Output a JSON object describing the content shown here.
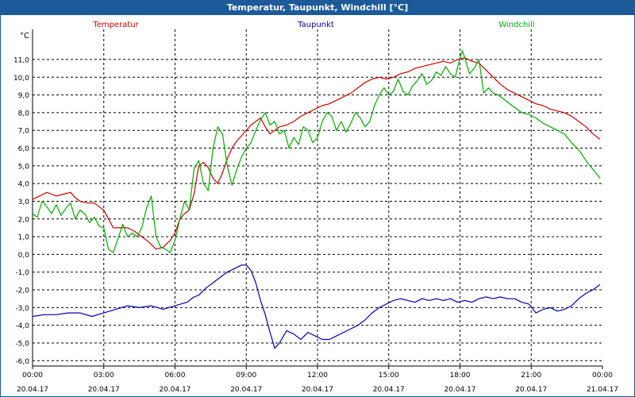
{
  "window": {
    "title": "Temperatur, Taupunkt, Windchill [°C]"
  },
  "chart_data": {
    "type": "line",
    "ylabel": "°C",
    "ylim": [
      -6.3,
      12.7
    ],
    "xlim": [
      0,
      24
    ],
    "grid": true,
    "legend_position": "top",
    "y_ticks": [
      {
        "value": 11,
        "label": "11,0"
      },
      {
        "value": 10,
        "label": "10,0"
      },
      {
        "value": 9,
        "label": "9,0"
      },
      {
        "value": 8,
        "label": "8,0"
      },
      {
        "value": 7,
        "label": "7,0"
      },
      {
        "value": 6,
        "label": "6,0"
      },
      {
        "value": 5,
        "label": "5,0"
      },
      {
        "value": 4,
        "label": "4,0"
      },
      {
        "value": 3,
        "label": "3,0"
      },
      {
        "value": 2,
        "label": "2,0"
      },
      {
        "value": 1,
        "label": "1,0"
      },
      {
        "value": 0,
        "label": "0,0"
      },
      {
        "value": -1,
        "label": "-1,0"
      },
      {
        "value": -2,
        "label": "-2,0"
      },
      {
        "value": -3,
        "label": "-3,0"
      },
      {
        "value": -4,
        "label": "-4,0"
      },
      {
        "value": -5,
        "label": "-5,0"
      },
      {
        "value": -6,
        "label": "-6,0"
      }
    ],
    "x_ticks": [
      {
        "value": 0,
        "time": "00:00",
        "date": "20.04.17"
      },
      {
        "value": 3,
        "time": "03:00",
        "date": "20.04.17"
      },
      {
        "value": 6,
        "time": "06:00",
        "date": "20.04.17"
      },
      {
        "value": 9,
        "time": "09:00",
        "date": "20.04.17"
      },
      {
        "value": 12,
        "time": "12:00",
        "date": "20.04.17"
      },
      {
        "value": 15,
        "time": "15:00",
        "date": "20.04.17"
      },
      {
        "value": 18,
        "time": "18:00",
        "date": "20.04.17"
      },
      {
        "value": 21,
        "time": "21:00",
        "date": "20.04.17"
      },
      {
        "value": 24,
        "time": "00:00",
        "date": "21.04.17"
      }
    ],
    "series": [
      {
        "name": "Temperatur",
        "color": "#cc0000",
        "points": [
          [
            0,
            3.1
          ],
          [
            0.3,
            3.3
          ],
          [
            0.6,
            3.5
          ],
          [
            0.8,
            3.4
          ],
          [
            1.0,
            3.3
          ],
          [
            1.3,
            3.4
          ],
          [
            1.6,
            3.5
          ],
          [
            1.8,
            3.2
          ],
          [
            2.0,
            3.0
          ],
          [
            2.3,
            2.9
          ],
          [
            2.6,
            2.9
          ],
          [
            2.8,
            2.7
          ],
          [
            3.0,
            2.5
          ],
          [
            3.2,
            2.0
          ],
          [
            3.4,
            1.5
          ],
          [
            3.7,
            1.5
          ],
          [
            4.0,
            1.5
          ],
          [
            4.3,
            1.3
          ],
          [
            4.6,
            1.0
          ],
          [
            4.9,
            0.7
          ],
          [
            5.2,
            0.3
          ],
          [
            5.5,
            0.4
          ],
          [
            5.8,
            0.8
          ],
          [
            6.0,
            1.2
          ],
          [
            6.2,
            2.0
          ],
          [
            6.4,
            2.3
          ],
          [
            6.6,
            2.5
          ],
          [
            6.8,
            3.4
          ],
          [
            7.0,
            5.0
          ],
          [
            7.2,
            5.2
          ],
          [
            7.4,
            4.9
          ],
          [
            7.6,
            4.3
          ],
          [
            7.8,
            4.0
          ],
          [
            8.0,
            4.6
          ],
          [
            8.2,
            5.4
          ],
          [
            8.4,
            6.0
          ],
          [
            8.6,
            6.4
          ],
          [
            8.8,
            6.7
          ],
          [
            9.0,
            7.0
          ],
          [
            9.2,
            7.3
          ],
          [
            9.4,
            7.5
          ],
          [
            9.6,
            7.7
          ],
          [
            9.8,
            7.2
          ],
          [
            10.0,
            6.8
          ],
          [
            10.2,
            7.0
          ],
          [
            10.4,
            7.2
          ],
          [
            10.7,
            7.3
          ],
          [
            11.0,
            7.5
          ],
          [
            11.3,
            7.8
          ],
          [
            11.6,
            8.0
          ],
          [
            11.9,
            8.2
          ],
          [
            12.2,
            8.4
          ],
          [
            12.5,
            8.5
          ],
          [
            12.8,
            8.7
          ],
          [
            13.1,
            8.9
          ],
          [
            13.4,
            9.1
          ],
          [
            13.7,
            9.4
          ],
          [
            14.0,
            9.7
          ],
          [
            14.3,
            9.9
          ],
          [
            14.6,
            10.0
          ],
          [
            14.9,
            9.9
          ],
          [
            15.2,
            10.0
          ],
          [
            15.5,
            10.2
          ],
          [
            15.8,
            10.3
          ],
          [
            16.1,
            10.5
          ],
          [
            16.4,
            10.6
          ],
          [
            16.7,
            10.7
          ],
          [
            17.0,
            10.8
          ],
          [
            17.3,
            10.9
          ],
          [
            17.6,
            10.8
          ],
          [
            17.9,
            11.0
          ],
          [
            18.2,
            11.1
          ],
          [
            18.5,
            10.9
          ],
          [
            18.8,
            10.8
          ],
          [
            19.1,
            10.4
          ],
          [
            19.4,
            10.0
          ],
          [
            19.7,
            9.6
          ],
          [
            20.0,
            9.3
          ],
          [
            20.3,
            9.1
          ],
          [
            20.6,
            8.9
          ],
          [
            20.9,
            8.7
          ],
          [
            21.2,
            8.5
          ],
          [
            21.5,
            8.4
          ],
          [
            21.8,
            8.2
          ],
          [
            22.1,
            8.1
          ],
          [
            22.4,
            8.0
          ],
          [
            22.7,
            7.8
          ],
          [
            23.0,
            7.5
          ],
          [
            23.3,
            7.2
          ],
          [
            23.6,
            6.8
          ],
          [
            23.9,
            6.5
          ]
        ]
      },
      {
        "name": "Taupunkt",
        "color": "#0000aa",
        "points": [
          [
            0,
            -3.5
          ],
          [
            0.5,
            -3.4
          ],
          [
            1.0,
            -3.4
          ],
          [
            1.5,
            -3.3
          ],
          [
            2.0,
            -3.3
          ],
          [
            2.5,
            -3.5
          ],
          [
            3.0,
            -3.3
          ],
          [
            3.5,
            -3.1
          ],
          [
            4.0,
            -2.9
          ],
          [
            4.5,
            -3.0
          ],
          [
            5.0,
            -2.9
          ],
          [
            5.5,
            -3.1
          ],
          [
            6.0,
            -2.9
          ],
          [
            6.5,
            -2.7
          ],
          [
            6.8,
            -2.4
          ],
          [
            7.0,
            -2.3
          ],
          [
            7.3,
            -1.9
          ],
          [
            7.6,
            -1.6
          ],
          [
            7.9,
            -1.3
          ],
          [
            8.2,
            -1.0
          ],
          [
            8.5,
            -0.8
          ],
          [
            8.8,
            -0.6
          ],
          [
            9.0,
            -0.6
          ],
          [
            9.2,
            -0.9
          ],
          [
            9.4,
            -1.6
          ],
          [
            9.6,
            -2.6
          ],
          [
            9.8,
            -3.4
          ],
          [
            10.0,
            -4.4
          ],
          [
            10.2,
            -5.3
          ],
          [
            10.4,
            -5.0
          ],
          [
            10.7,
            -4.3
          ],
          [
            11.0,
            -4.5
          ],
          [
            11.3,
            -4.8
          ],
          [
            11.6,
            -4.4
          ],
          [
            11.9,
            -4.6
          ],
          [
            12.2,
            -4.8
          ],
          [
            12.5,
            -4.8
          ],
          [
            12.8,
            -4.6
          ],
          [
            13.1,
            -4.4
          ],
          [
            13.4,
            -4.2
          ],
          [
            13.7,
            -4.0
          ],
          [
            14.0,
            -3.7
          ],
          [
            14.3,
            -3.3
          ],
          [
            14.6,
            -3.0
          ],
          [
            14.9,
            -2.8
          ],
          [
            15.2,
            -2.6
          ],
          [
            15.5,
            -2.5
          ],
          [
            15.8,
            -2.6
          ],
          [
            16.1,
            -2.7
          ],
          [
            16.4,
            -2.5
          ],
          [
            16.7,
            -2.6
          ],
          [
            17.0,
            -2.5
          ],
          [
            17.3,
            -2.6
          ],
          [
            17.6,
            -2.5
          ],
          [
            17.9,
            -2.7
          ],
          [
            18.2,
            -2.6
          ],
          [
            18.5,
            -2.7
          ],
          [
            18.8,
            -2.5
          ],
          [
            19.1,
            -2.4
          ],
          [
            19.4,
            -2.5
          ],
          [
            19.7,
            -2.4
          ],
          [
            20.0,
            -2.5
          ],
          [
            20.3,
            -2.5
          ],
          [
            20.6,
            -2.7
          ],
          [
            20.9,
            -2.8
          ],
          [
            21.2,
            -3.3
          ],
          [
            21.5,
            -3.1
          ],
          [
            21.8,
            -3.0
          ],
          [
            22.1,
            -3.2
          ],
          [
            22.4,
            -3.1
          ],
          [
            22.7,
            -2.9
          ],
          [
            23.0,
            -2.5
          ],
          [
            23.3,
            -2.2
          ],
          [
            23.6,
            -2.0
          ],
          [
            23.9,
            -1.7
          ]
        ]
      },
      {
        "name": "Windchill",
        "color": "#00aa00",
        "points": [
          [
            0,
            2.3
          ],
          [
            0.2,
            2.1
          ],
          [
            0.4,
            3.0
          ],
          [
            0.6,
            2.7
          ],
          [
            0.8,
            2.3
          ],
          [
            1.0,
            2.8
          ],
          [
            1.2,
            2.2
          ],
          [
            1.4,
            2.6
          ],
          [
            1.6,
            2.9
          ],
          [
            1.8,
            2.0
          ],
          [
            2.0,
            2.5
          ],
          [
            2.2,
            2.3
          ],
          [
            2.4,
            1.8
          ],
          [
            2.6,
            2.1
          ],
          [
            2.8,
            1.6
          ],
          [
            3.0,
            1.5
          ],
          [
            3.2,
            0.3
          ],
          [
            3.4,
            0.1
          ],
          [
            3.6,
            0.9
          ],
          [
            3.8,
            1.7
          ],
          [
            4.0,
            1.0
          ],
          [
            4.2,
            1.2
          ],
          [
            4.4,
            1.0
          ],
          [
            4.6,
            1.5
          ],
          [
            4.8,
            2.6
          ],
          [
            5.0,
            3.3
          ],
          [
            5.2,
            1.0
          ],
          [
            5.4,
            0.4
          ],
          [
            5.6,
            0.3
          ],
          [
            5.8,
            0.1
          ],
          [
            6.0,
            0.8
          ],
          [
            6.2,
            2.0
          ],
          [
            6.4,
            3.0
          ],
          [
            6.6,
            2.5
          ],
          [
            6.8,
            4.8
          ],
          [
            7.0,
            5.3
          ],
          [
            7.2,
            4.0
          ],
          [
            7.4,
            3.6
          ],
          [
            7.6,
            6.0
          ],
          [
            7.8,
            7.2
          ],
          [
            8.0,
            6.8
          ],
          [
            8.2,
            5.0
          ],
          [
            8.4,
            3.9
          ],
          [
            8.6,
            4.8
          ],
          [
            8.8,
            5.5
          ],
          [
            9.0,
            6.0
          ],
          [
            9.2,
            6.3
          ],
          [
            9.4,
            7.0
          ],
          [
            9.6,
            7.6
          ],
          [
            9.8,
            8.0
          ],
          [
            10.0,
            7.3
          ],
          [
            10.2,
            7.5
          ],
          [
            10.4,
            6.8
          ],
          [
            10.6,
            7.0
          ],
          [
            10.8,
            6.0
          ],
          [
            11.0,
            6.6
          ],
          [
            11.2,
            6.2
          ],
          [
            11.4,
            7.2
          ],
          [
            11.6,
            7.0
          ],
          [
            11.8,
            6.3
          ],
          [
            12.0,
            6.6
          ],
          [
            12.2,
            7.5
          ],
          [
            12.4,
            8.0
          ],
          [
            12.6,
            7.8
          ],
          [
            12.8,
            7.0
          ],
          [
            13.0,
            7.5
          ],
          [
            13.2,
            6.9
          ],
          [
            13.4,
            7.4
          ],
          [
            13.6,
            8.0
          ],
          [
            13.8,
            7.7
          ],
          [
            14.0,
            7.2
          ],
          [
            14.2,
            7.5
          ],
          [
            14.4,
            8.4
          ],
          [
            14.6,
            9.0
          ],
          [
            14.8,
            9.4
          ],
          [
            15.0,
            9.0
          ],
          [
            15.2,
            9.2
          ],
          [
            15.4,
            9.9
          ],
          [
            15.6,
            9.2
          ],
          [
            15.8,
            9.0
          ],
          [
            16.0,
            9.5
          ],
          [
            16.2,
            9.8
          ],
          [
            16.4,
            10.2
          ],
          [
            16.6,
            9.6
          ],
          [
            16.8,
            9.8
          ],
          [
            17.0,
            10.3
          ],
          [
            17.2,
            10.1
          ],
          [
            17.4,
            10.6
          ],
          [
            17.6,
            10.2
          ],
          [
            17.8,
            10.0
          ],
          [
            18.0,
            11.1
          ],
          [
            18.1,
            11.5
          ],
          [
            18.2,
            11.1
          ],
          [
            18.4,
            10.2
          ],
          [
            18.6,
            10.5
          ],
          [
            18.8,
            11.0
          ],
          [
            19.0,
            9.1
          ],
          [
            19.2,
            9.4
          ],
          [
            19.4,
            9.1
          ],
          [
            19.6,
            9.0
          ],
          [
            19.8,
            8.8
          ],
          [
            20.0,
            8.6
          ],
          [
            20.2,
            8.4
          ],
          [
            20.4,
            8.2
          ],
          [
            20.6,
            8.0
          ],
          [
            20.9,
            7.9
          ],
          [
            21.2,
            7.7
          ],
          [
            21.5,
            7.4
          ],
          [
            21.8,
            7.2
          ],
          [
            22.1,
            7.0
          ],
          [
            22.4,
            6.8
          ],
          [
            22.7,
            6.3
          ],
          [
            23.0,
            5.9
          ],
          [
            23.3,
            5.3
          ],
          [
            23.6,
            4.8
          ],
          [
            23.9,
            4.3
          ]
        ]
      }
    ]
  }
}
